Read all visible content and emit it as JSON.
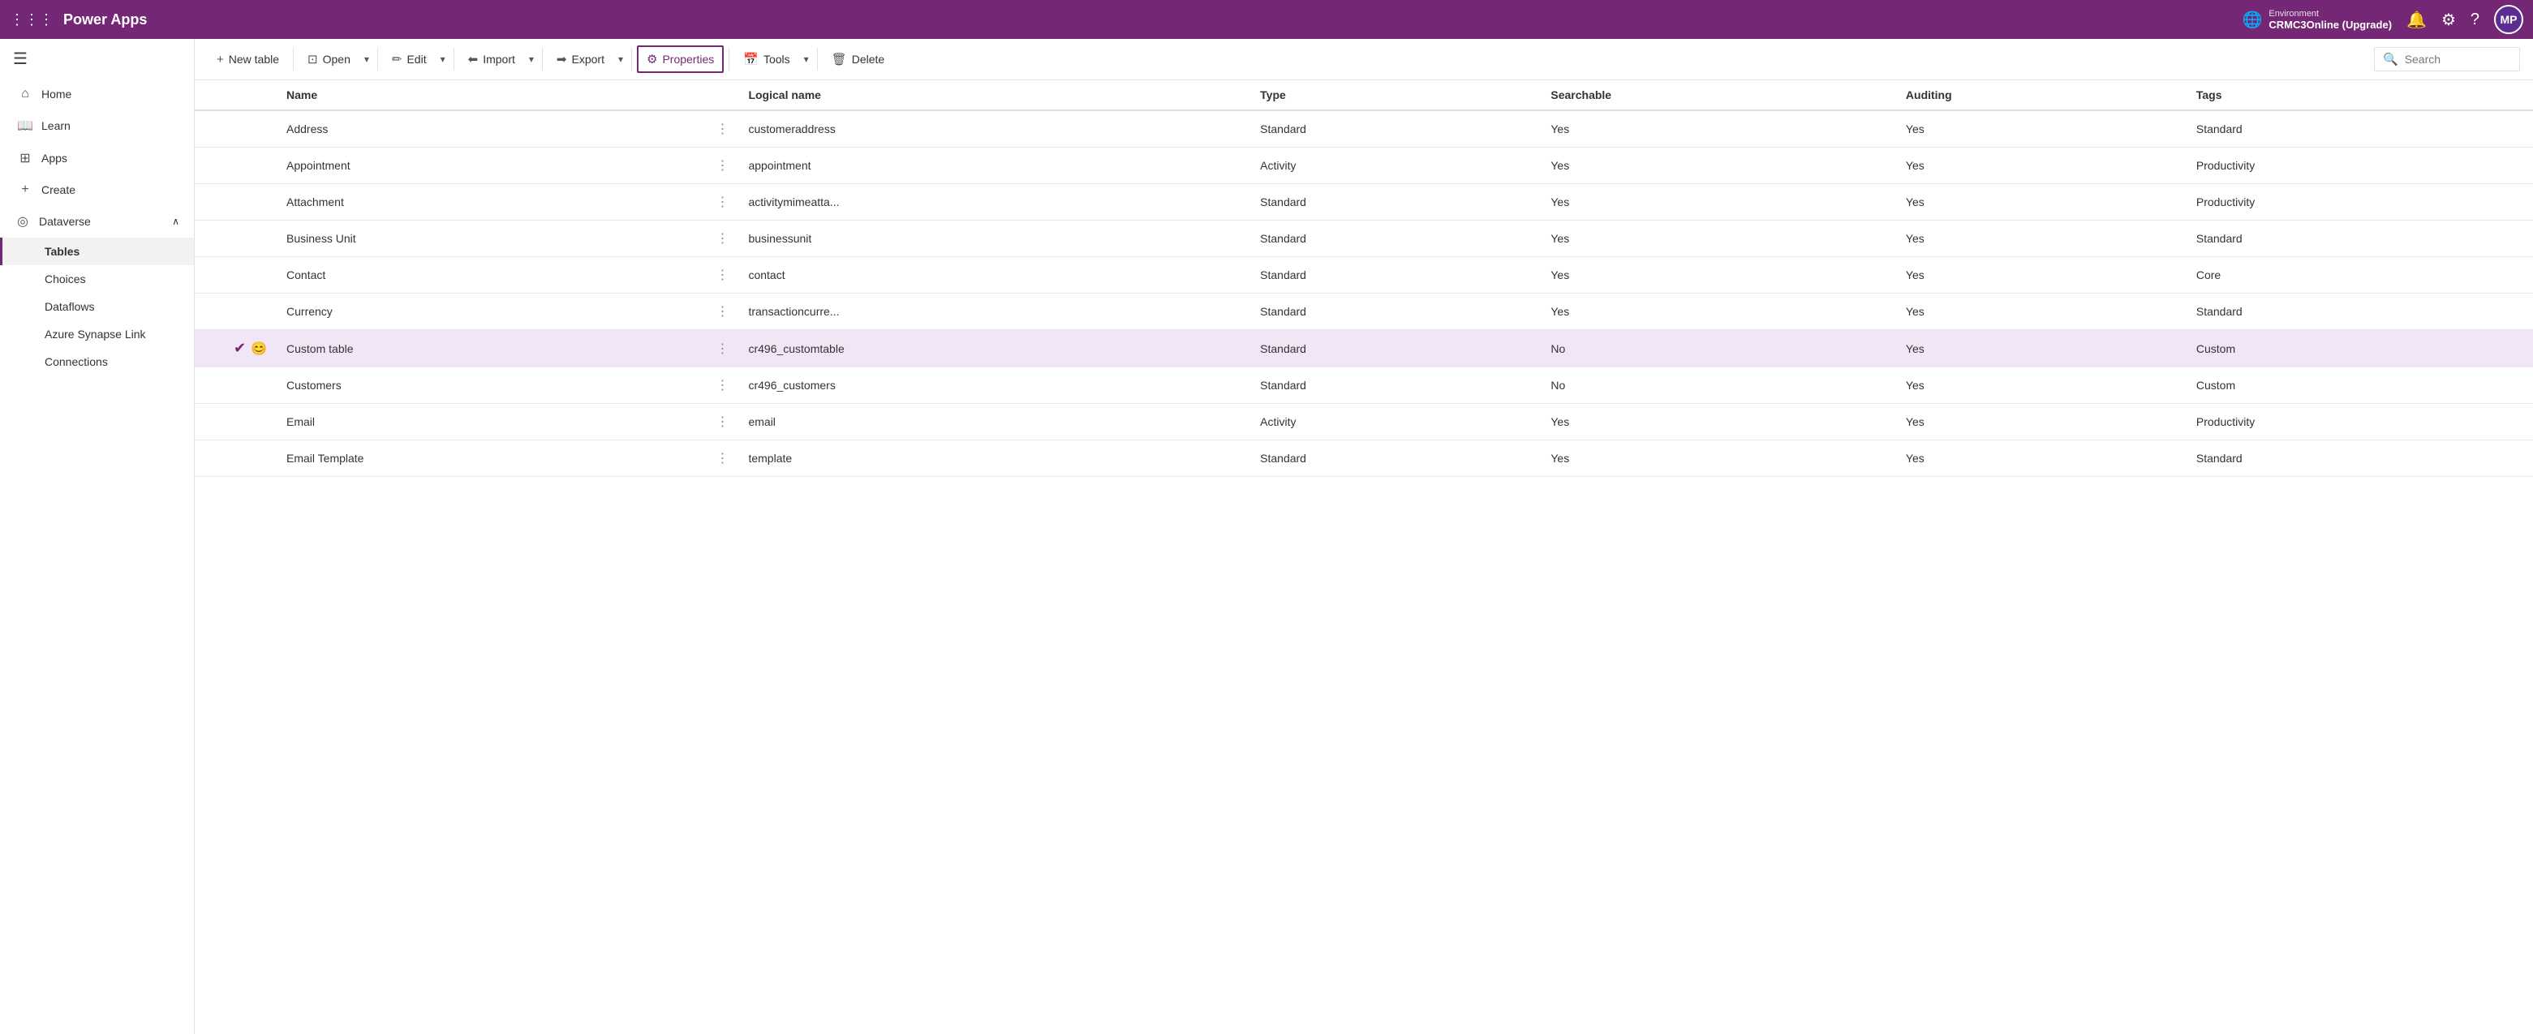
{
  "topnav": {
    "grid_icon": "⋮⋮⋮",
    "logo": "Power Apps",
    "environment_label": "Environment",
    "environment_name": "CRMC3Online (Upgrade)",
    "bell_icon": "🔔",
    "settings_icon": "⚙",
    "help_icon": "?",
    "avatar_label": "MP"
  },
  "sidebar": {
    "menu_icon": "☰",
    "items": [
      {
        "id": "home",
        "icon": "⌂",
        "label": "Home",
        "active": false
      },
      {
        "id": "learn",
        "icon": "📖",
        "label": "Learn",
        "active": false
      },
      {
        "id": "apps",
        "icon": "⊞",
        "label": "Apps",
        "active": false
      },
      {
        "id": "create",
        "icon": "+",
        "label": "Create",
        "active": false
      }
    ],
    "dataverse_section": {
      "icon": "◎",
      "label": "Dataverse",
      "chevron": "∧",
      "sub_items": [
        {
          "id": "tables",
          "label": "Tables",
          "active": true
        },
        {
          "id": "choices",
          "label": "Choices",
          "active": false
        },
        {
          "id": "dataflows",
          "label": "Dataflows",
          "active": false
        },
        {
          "id": "azure-synapse",
          "label": "Azure Synapse Link",
          "active": false
        },
        {
          "id": "connections",
          "label": "Connections",
          "active": false
        }
      ]
    }
  },
  "toolbar": {
    "new_table_label": "New table",
    "open_label": "Open",
    "edit_label": "Edit",
    "import_label": "Import",
    "export_label": "Export",
    "properties_label": "Properties",
    "tools_label": "Tools",
    "delete_label": "Delete",
    "search_placeholder": "Search"
  },
  "table": {
    "columns": [
      {
        "id": "row-select",
        "label": ""
      },
      {
        "id": "row-icons",
        "label": ""
      },
      {
        "id": "name",
        "label": "Name"
      },
      {
        "id": "more",
        "label": ""
      },
      {
        "id": "logical-name",
        "label": "Logical name"
      },
      {
        "id": "type",
        "label": "Type"
      },
      {
        "id": "searchable",
        "label": "Searchable"
      },
      {
        "id": "auditing",
        "label": "Auditing"
      },
      {
        "id": "tags",
        "label": "Tags"
      }
    ],
    "rows": [
      {
        "id": "address",
        "selected": false,
        "check": false,
        "emoji": "",
        "name": "Address",
        "logical": "customeraddress",
        "type": "Standard",
        "searchable": "Yes",
        "auditing": "Yes",
        "tags": "Standard"
      },
      {
        "id": "appointment",
        "selected": false,
        "check": false,
        "emoji": "",
        "name": "Appointment",
        "logical": "appointment",
        "type": "Activity",
        "searchable": "Yes",
        "auditing": "Yes",
        "tags": "Productivity"
      },
      {
        "id": "attachment",
        "selected": false,
        "check": false,
        "emoji": "",
        "name": "Attachment",
        "logical": "activitymimeatta...",
        "type": "Standard",
        "searchable": "Yes",
        "auditing": "Yes",
        "tags": "Productivity"
      },
      {
        "id": "business-unit",
        "selected": false,
        "check": false,
        "emoji": "",
        "name": "Business Unit",
        "logical": "businessunit",
        "type": "Standard",
        "searchable": "Yes",
        "auditing": "Yes",
        "tags": "Standard"
      },
      {
        "id": "contact",
        "selected": false,
        "check": false,
        "emoji": "",
        "name": "Contact",
        "logical": "contact",
        "type": "Standard",
        "searchable": "Yes",
        "auditing": "Yes",
        "tags": "Core"
      },
      {
        "id": "currency",
        "selected": false,
        "check": false,
        "emoji": "",
        "name": "Currency",
        "logical": "transactioncurre...",
        "type": "Standard",
        "searchable": "Yes",
        "auditing": "Yes",
        "tags": "Standard"
      },
      {
        "id": "custom-table",
        "selected": true,
        "check": true,
        "emoji": "😊",
        "name": "Custom table",
        "logical": "cr496_customtable",
        "type": "Standard",
        "searchable": "No",
        "auditing": "Yes",
        "tags": "Custom"
      },
      {
        "id": "customers",
        "selected": false,
        "check": false,
        "emoji": "",
        "name": "Customers",
        "logical": "cr496_customers",
        "type": "Standard",
        "searchable": "No",
        "auditing": "Yes",
        "tags": "Custom"
      },
      {
        "id": "email",
        "selected": false,
        "check": false,
        "emoji": "",
        "name": "Email",
        "logical": "email",
        "type": "Activity",
        "searchable": "Yes",
        "auditing": "Yes",
        "tags": "Productivity"
      },
      {
        "id": "email-template",
        "selected": false,
        "check": false,
        "emoji": "",
        "name": "Email Template",
        "logical": "template",
        "type": "Standard",
        "searchable": "Yes",
        "auditing": "Yes",
        "tags": "Standard"
      }
    ]
  }
}
